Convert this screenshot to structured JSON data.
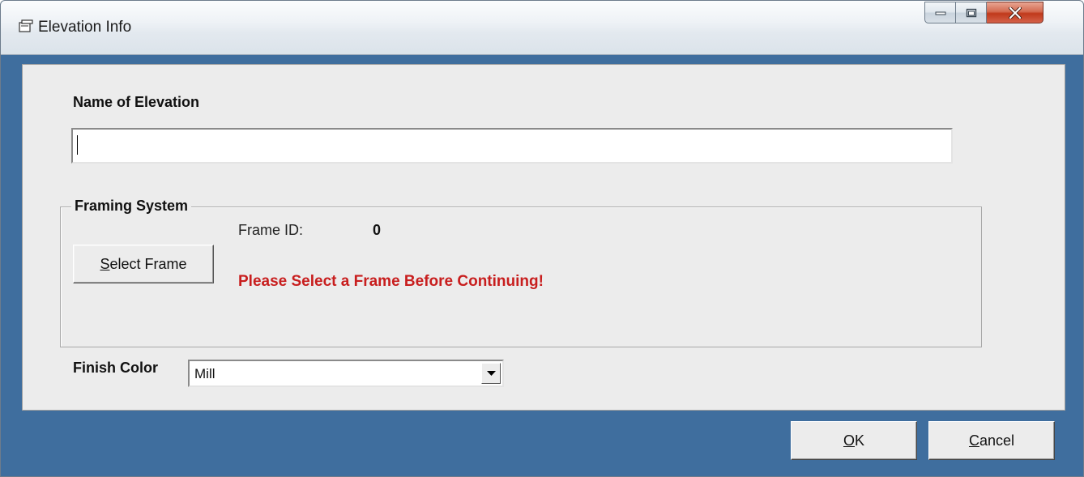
{
  "window": {
    "title": "Elevation Info",
    "icon": "window-app-icon",
    "controls": [
      "minimize-icon",
      "maximize-icon",
      "close-icon"
    ]
  },
  "form": {
    "name_label": "Name of Elevation",
    "name_value": "",
    "framing_group_label": "Framing System",
    "frame_id_label": "Frame ID:",
    "frame_id_value": "0",
    "select_frame_button": {
      "mnemonic": "S",
      "rest": "elect Frame"
    },
    "warning_text": "Please Select a Frame Before Continuing!",
    "finish_color_label": "Finish Color",
    "finish_color_value": "Mill"
  },
  "buttons": {
    "ok": {
      "mnemonic": "O",
      "rest": "K"
    },
    "cancel": {
      "mnemonic": "C",
      "rest": "ancel"
    }
  },
  "colors": {
    "frame_blue": "#3f6e9e",
    "dialog_bg": "#ececec",
    "warning_red": "#c81e1e",
    "close_button_red": "#c0391b"
  }
}
